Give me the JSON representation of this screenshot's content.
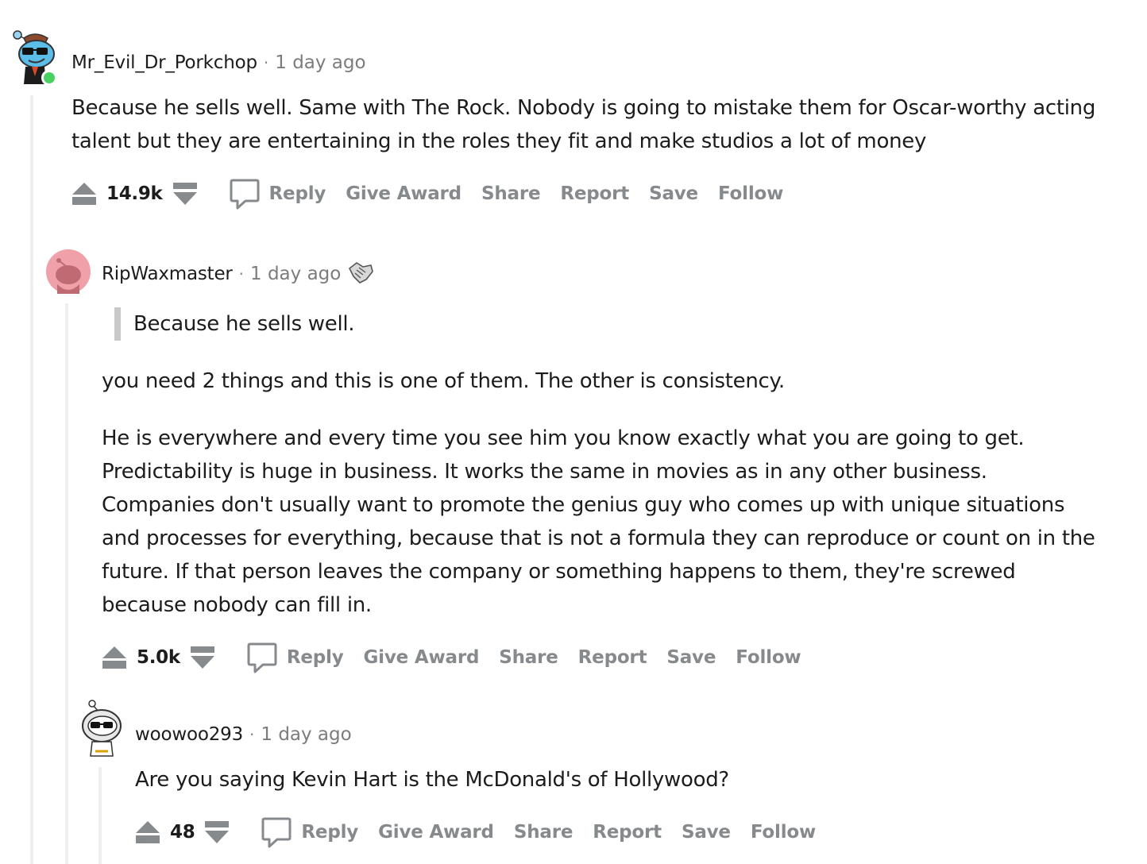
{
  "actions": {
    "reply": "Reply",
    "give_award": "Give Award",
    "share": "Share",
    "report": "Report",
    "save": "Save",
    "follow": "Follow"
  },
  "comments": [
    {
      "username": "Mr_Evil_Dr_Porkchop",
      "time": "1 day ago",
      "text": "Because he sells well. Same with The Rock. Nobody is going to mistake them for Oscar-worthy acting talent but they are entertaining in the roles they fit and make studios a lot of money",
      "score": "14.9k",
      "online": true
    },
    {
      "username": "RipWaxmaster",
      "time": "1 day ago",
      "award_icon": "handshake-award-icon",
      "quote": "Because he sells well.",
      "paragraphs": [
        "you need 2 things and this is one of them. The other is consistency.",
        "He is everywhere and every time you see him you know exactly what you are going to get. Predictability is huge in business. It works the same in movies as in any other business. Companies don't usually want to promote the genius guy who comes up with unique situations and processes for everything, because that is not a formula they can reproduce or count on in the future. If that person leaves the company or something happens to them, they're screwed because nobody can fill in."
      ],
      "score": "5.0k"
    },
    {
      "username": "woowoo293",
      "time": "1 day ago",
      "text": "Are you saying Kevin Hart is the McDonald's of Hollywood?",
      "score": "48"
    }
  ],
  "colors": {
    "accent_online": "#46d160",
    "action_gray": "#878a8c",
    "thread_line": "#edeff1",
    "avatar_pink": "#f0a0a8"
  }
}
